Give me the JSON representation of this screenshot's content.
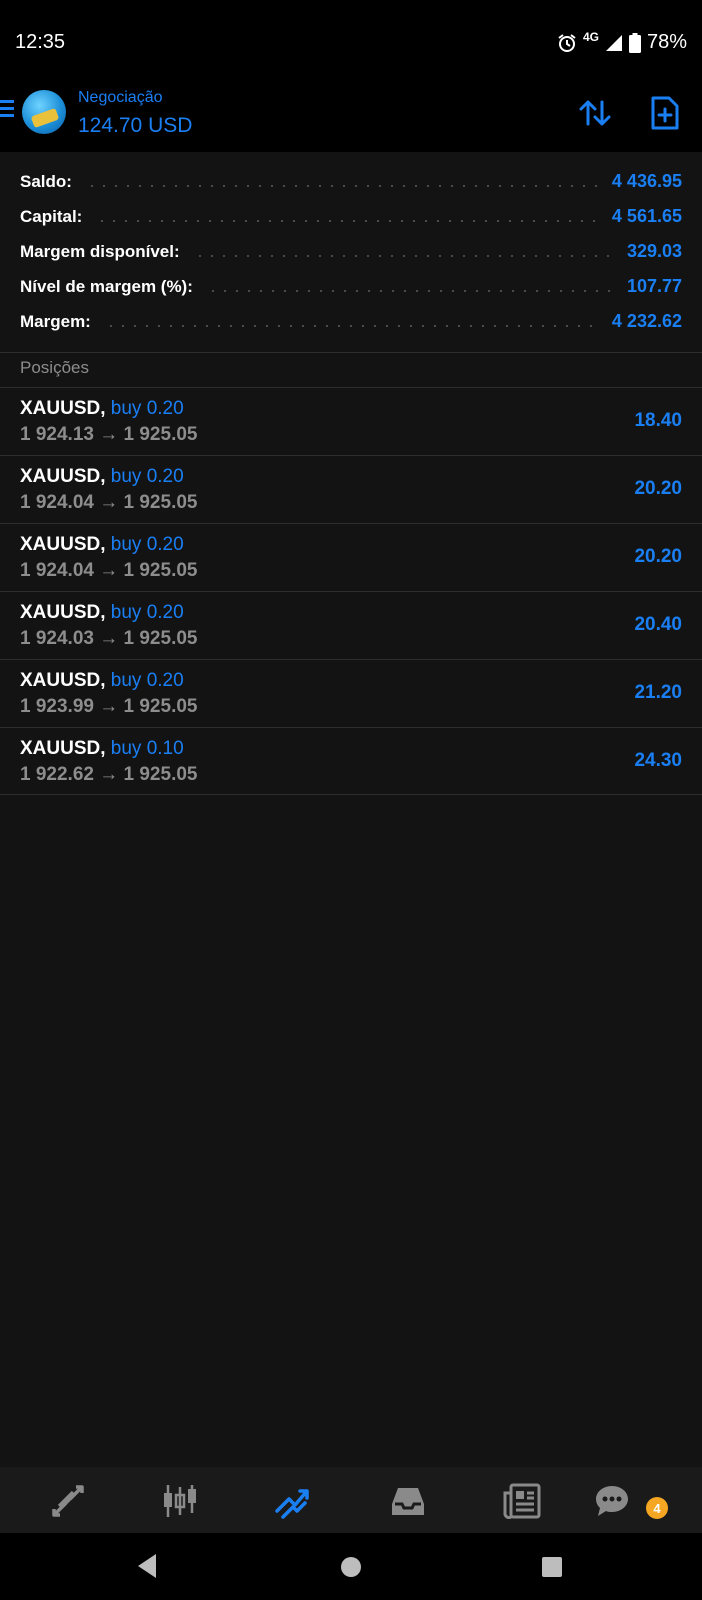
{
  "status_bar": {
    "time": "12:35",
    "network": "4G",
    "battery": "78%"
  },
  "header": {
    "title": "Negociação",
    "amount": "124.70 USD"
  },
  "summary": [
    {
      "label": "Saldo:",
      "value": "4 436.95"
    },
    {
      "label": "Capital:",
      "value": "4 561.65"
    },
    {
      "label": "Margem disponível:",
      "value": "329.03"
    },
    {
      "label": "Nível de margem (%):",
      "value": "107.77"
    },
    {
      "label": "Margem:",
      "value": "4 232.62"
    }
  ],
  "positions_header": "Posições",
  "positions": [
    {
      "symbol": "XAUUSD,",
      "side": "buy 0.20",
      "prices": "1 924.13 → 1 925.05",
      "profit": "18.40"
    },
    {
      "symbol": "XAUUSD,",
      "side": "buy 0.20",
      "prices": "1 924.04 → 1 925.05",
      "profit": "20.20"
    },
    {
      "symbol": "XAUUSD,",
      "side": "buy 0.20",
      "prices": "1 924.04 → 1 925.05",
      "profit": "20.20"
    },
    {
      "symbol": "XAUUSD,",
      "side": "buy 0.20",
      "prices": "1 924.03 → 1 925.05",
      "profit": "20.40"
    },
    {
      "symbol": "XAUUSD,",
      "side": "buy 0.20",
      "prices": "1 923.99 → 1 925.05",
      "profit": "21.20"
    },
    {
      "symbol": "XAUUSD,",
      "side": "buy 0.10",
      "prices": "1 922.62 → 1 925.05",
      "profit": "24.30"
    }
  ],
  "tabbar": {
    "items": [
      {
        "icon": "quotes-icon",
        "active": false
      },
      {
        "icon": "chart-icon",
        "active": false
      },
      {
        "icon": "trade-icon",
        "active": true
      },
      {
        "icon": "history-icon",
        "active": false
      },
      {
        "icon": "news-icon",
        "active": false
      },
      {
        "icon": "chat-icon",
        "active": false
      }
    ],
    "chat_badge": "4"
  },
  "colors": {
    "accent": "#1b7ff4",
    "background": "#131313",
    "muted": "#8d8d8d",
    "badge": "#f5a623"
  }
}
